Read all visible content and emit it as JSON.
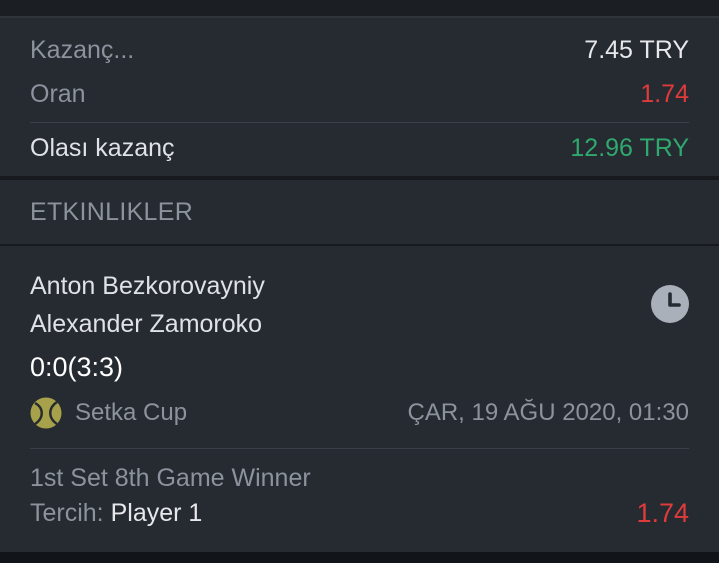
{
  "summary": {
    "stake_label": "Kazanç...",
    "stake_value": "7.45 TRY",
    "odds_label": "Oran",
    "odds_value": "1.74",
    "potential_label": "Olası kazanç",
    "potential_value": "12.96 TRY"
  },
  "events_section": {
    "title": "ETKINLIKLER"
  },
  "event": {
    "home_player": "Anton Bezkorovayniy",
    "away_player": "Alexander Zamoroko",
    "score": "0:0(3:3)",
    "league": "Setka Cup",
    "datetime": "ÇAR, 19 AĞU 2020, 01:30",
    "market": "1st Set 8th Game Winner",
    "pick_label": "Tercih:",
    "pick_value": "Player 1",
    "odds": "1.74",
    "icons": {
      "status": "clock-icon",
      "sport": "tennis-ball-icon"
    }
  },
  "colors": {
    "background": "#262a31",
    "odds_red": "#e03b3b",
    "win_green": "#2fa96d",
    "muted_text": "#8c939c"
  }
}
